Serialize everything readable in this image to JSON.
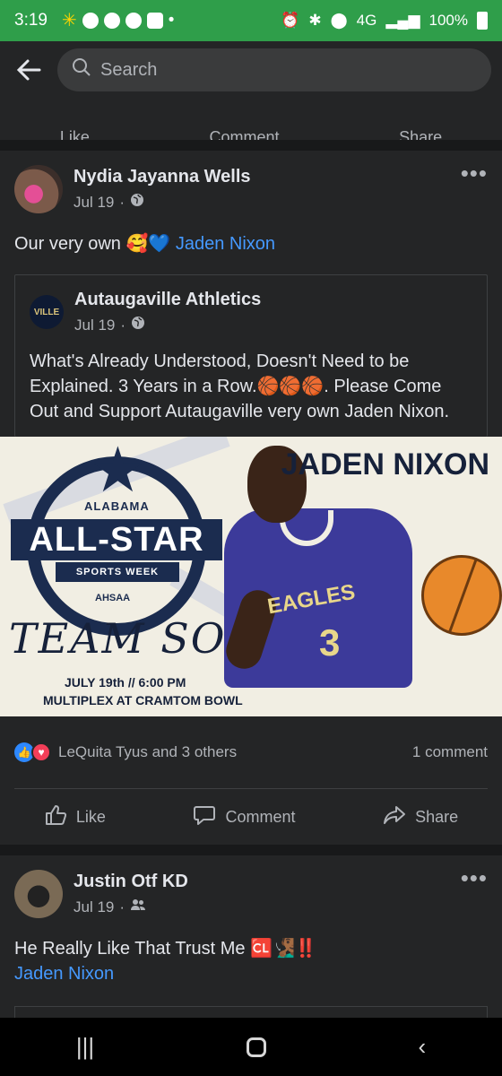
{
  "status_bar": {
    "time": "3:19",
    "network": "4G",
    "battery": "100%"
  },
  "search": {
    "placeholder": "Search"
  },
  "previous_post": {
    "like": "Like",
    "comment": "Comment",
    "share": "Share"
  },
  "post1": {
    "author": "Nydia Jayanna Wells",
    "date": "Jul 19",
    "text_prefix": "Our very own",
    "emojis": "🥰💙",
    "mention": "Jaden Nixon",
    "shared": {
      "author": "Autaugaville Athletics",
      "date": "Jul 19",
      "text": "What's Already Understood, Doesn't Need to be Explained.  3 Years in a Row.🏀🏀🏀.  Please Come Out and Support Autaugaville very own Jaden Nixon.",
      "avatar_text": "VILLE"
    },
    "image": {
      "state": "ALABAMA",
      "banner": "ALL-STAR",
      "week": "SPORTS WEEK",
      "org": "AHSAA",
      "team": "TEAM SOUTH",
      "date_time": "JULY 19th // 6:00 PM",
      "venue": "MULTIPLEX AT CRAMTOM BOWL",
      "player_name": "JADEN NIXON",
      "jersey_word": "EAGLES",
      "jersey_number": "3"
    },
    "reactions_text": "LeQuita Tyus and 3 others",
    "comments_text": "1 comment",
    "actions": {
      "like": "Like",
      "comment": "Comment",
      "share": "Share"
    }
  },
  "post2": {
    "author": "Justin Otf KD",
    "date": "Jul 19",
    "text": "He Really Like That Trust Me",
    "emojis": "🆑🧏🏾‍♂️‼️",
    "mention": "Jaden Nixon"
  },
  "colors": {
    "status_bar": "#2f9e4a",
    "card_bg": "#242526",
    "feed_bg": "#18191a",
    "link": "#4599ff",
    "like_blue": "#2d88ff",
    "love_red": "#f33e58"
  }
}
